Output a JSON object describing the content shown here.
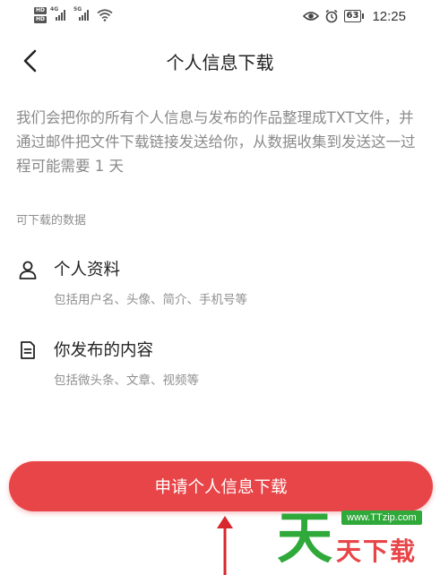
{
  "status_bar": {
    "hd_1": "HD",
    "hd_2": "HD",
    "net_1": "4G",
    "net_2": "5G",
    "battery": "63",
    "time": "12:25"
  },
  "header": {
    "back_icon": "chevron-left-icon",
    "title": "个人信息下载"
  },
  "description": "我们会把你的所有个人信息与发布的作品整理成TXT文件，并通过邮件把文件下载链接发送给你，从数据收集到发送这一过程可能需要 1 天",
  "section_label": "可下载的数据",
  "items": [
    {
      "icon": "person-icon",
      "title": "个人资料",
      "subtitle": "包括用户名、头像、简介、手机号等"
    },
    {
      "icon": "document-icon",
      "title": "你发布的内容",
      "subtitle": "包括微头条、文章、视频等"
    }
  ],
  "cta_label": "申请个人信息下载",
  "colors": {
    "accent": "#e84548",
    "watermark_green": "#2fa93a"
  },
  "watermark": {
    "char": "天",
    "url": "www.TTzip.com",
    "text": "天下载"
  }
}
